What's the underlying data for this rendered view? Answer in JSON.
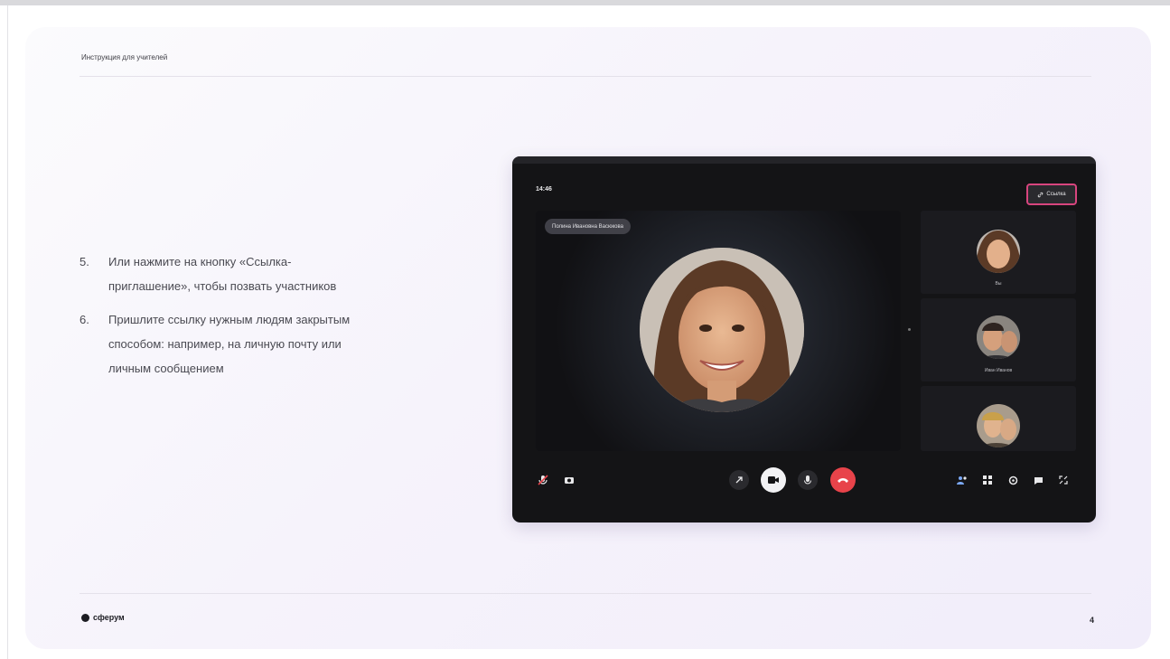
{
  "slide": {
    "header": "Инструкция для учителей",
    "steps": [
      {
        "number": "5.",
        "text": "Или нажмите на кнопку «Ссылка-приглашение», чтобы позвать участников"
      },
      {
        "number": "6.",
        "text": "Пришлите ссылку нужным людям закрытым способом: например, на личную почту или личным сообщением"
      }
    ],
    "brand": "сферум",
    "page_number": "4"
  },
  "call": {
    "time": "14:46",
    "invite_button": "Ссылка",
    "main_speaker_name": "Полина Ивановна Васюкова",
    "participants": [
      {
        "name": "Вы"
      },
      {
        "name": "Иван Иванов"
      },
      {
        "name": ""
      }
    ],
    "colors": {
      "invite_highlight": "#d8457e",
      "end_call": "#e8434a",
      "window_bg": "#141416"
    },
    "controls_left": [
      "mic-off-icon",
      "camera-icon"
    ],
    "controls_center": [
      "screen-share-icon",
      "video-icon",
      "microphone-icon",
      "end-call-icon"
    ],
    "controls_right": [
      "participants-icon",
      "grid-icon",
      "settings-icon",
      "chat-icon",
      "fullscreen-icon"
    ]
  }
}
